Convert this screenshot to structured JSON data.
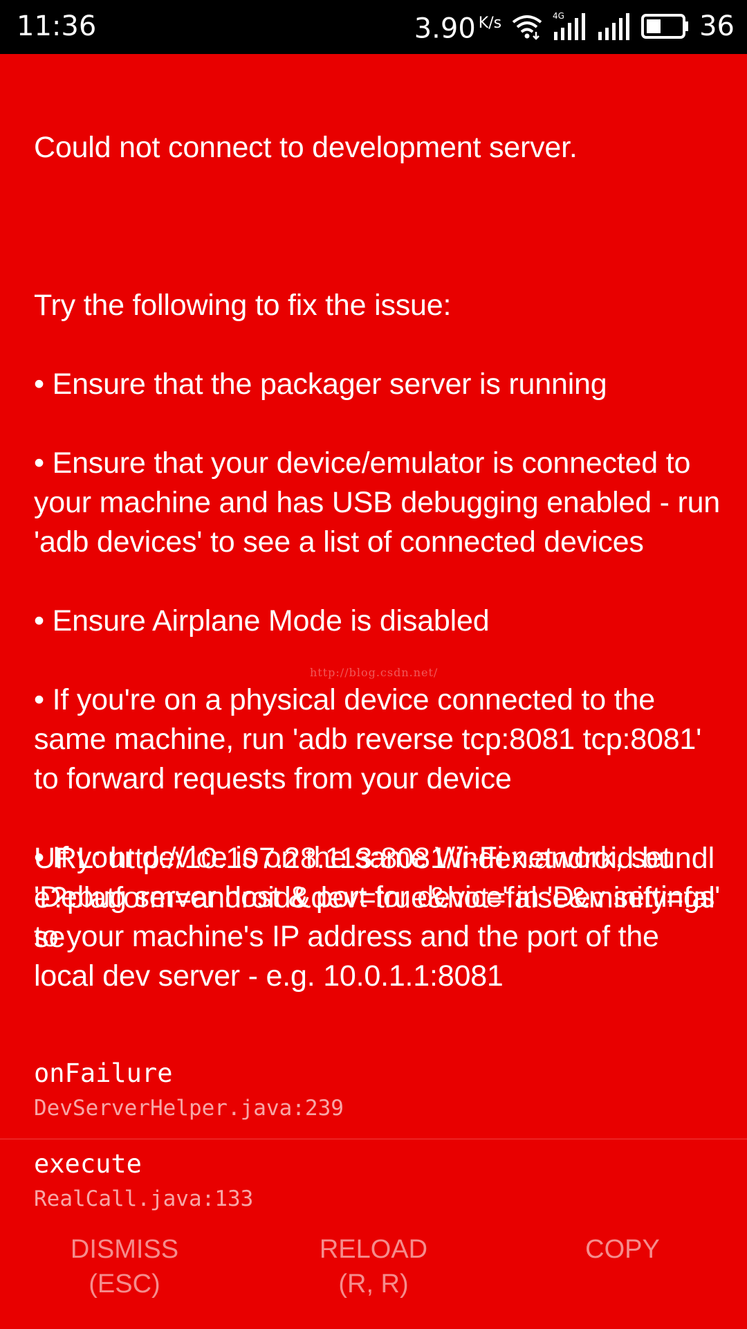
{
  "status_bar": {
    "time": "11:36",
    "net_speed": "3.90",
    "net_speed_unit": "K/s",
    "network_type": "4G",
    "battery": "36",
    "icons": [
      "wifi-icon",
      "signal-4g-icon",
      "signal-icon",
      "battery-icon"
    ]
  },
  "error": {
    "title": "Could not connect to development server.",
    "intro": "Try the following to fix the issue:",
    "bullets": [
      "• Ensure that the packager server is running",
      "• Ensure that your device/emulator is connected to your machine and has USB debugging enabled - run 'adb devices' to see a list of connected devices",
      "• Ensure Airplane Mode is disabled",
      "• If you're on a physical device connected to the same machine, run 'adb reverse tcp:8081 tcp:8081' to forward requests from your device",
      "• If your device is on the same Wi-Fi network, set 'Debug server host & port for device' in 'Dev settings' to your machine's IP address and the port of the local dev server - e.g. 10.0.1.1:8081"
    ],
    "url": "URL: http://10.107.28.113:8081/index.android.bundle?platform=android&dev=true&hot=false&minify=false"
  },
  "stack": [
    {
      "method": "onFailure",
      "file": "DevServerHelper.java:239"
    },
    {
      "method": "execute",
      "file": "RealCall.java:133"
    }
  ],
  "watermark": "http://blog.csdn.net/",
  "buttons": {
    "dismiss": "DISMISS\n(ESC)",
    "reload": "RELOAD\n(R, R)",
    "copy": "COPY"
  },
  "colors": {
    "background": "#e80000",
    "status_bar": "#000000",
    "text": "#ffffff"
  }
}
